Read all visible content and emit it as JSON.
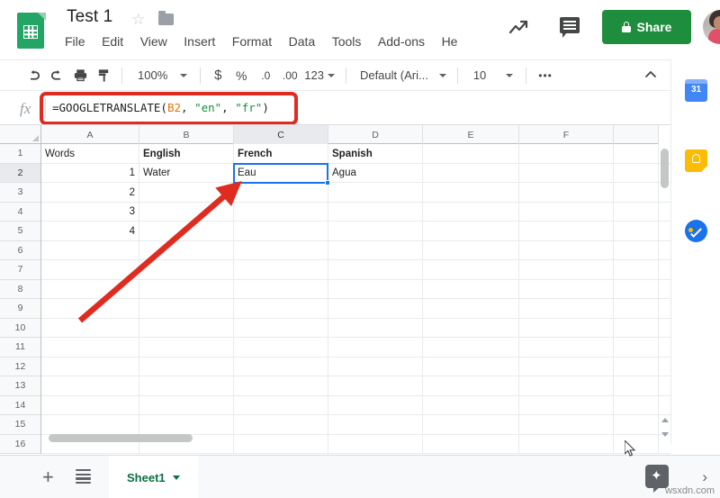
{
  "app": {
    "name": "Google Sheets",
    "logo_icon": "sheets-logo-icon",
    "doc_title": "Test 1",
    "star_icon": "star-icon",
    "folder_icon": "folder-icon"
  },
  "menubar": {
    "items": [
      {
        "label": "File"
      },
      {
        "label": "Edit"
      },
      {
        "label": "View"
      },
      {
        "label": "Insert"
      },
      {
        "label": "Format"
      },
      {
        "label": "Data"
      },
      {
        "label": "Tools"
      },
      {
        "label": "Add-ons"
      },
      {
        "label": "He"
      }
    ]
  },
  "top_actions": {
    "history_icon": "activity-trend-icon",
    "comment_icon": "comment-icon",
    "share_label": "Share",
    "share_lock_icon": "lock-icon",
    "share_color": "#1e8e3e",
    "avatar_icon": "user-avatar"
  },
  "toolbar": {
    "undo_icon": "undo-icon",
    "redo_icon": "redo-icon",
    "print_icon": "print-icon",
    "paint_icon": "paint-format-icon",
    "zoom_value": "100%",
    "currency_label": "$",
    "percent_label": "%",
    "decrease_decimal_label": ".0",
    "increase_decimal_label": ".00",
    "number_format_label": "123",
    "font_family": "Default (Ari...",
    "font_size": "10",
    "more_label": "•••",
    "collapse_icon": "chevron-up-icon"
  },
  "formula_bar": {
    "fx_label": "fx",
    "formula_full": "=GOOGLETRANSLATE(B2, \"en\", \"fr\")",
    "parts": {
      "fn": "=GOOGLETRANSLATE(",
      "ref": "B2",
      "sep1": ", ",
      "arg1": "\"en\"",
      "sep2": ", ",
      "arg2": "\"fr\"",
      "close": ")"
    },
    "ref_color": "#e8710a",
    "string_color": "#1a8f3c",
    "highlight_color": "#e02b20"
  },
  "grid": {
    "columns": [
      {
        "label": "A",
        "width": 109,
        "selected": false
      },
      {
        "label": "B",
        "width": 105,
        "selected": false
      },
      {
        "label": "C",
        "width": 105,
        "selected": true
      },
      {
        "label": "D",
        "width": 105,
        "selected": false
      },
      {
        "label": "E",
        "width": 107,
        "selected": false
      },
      {
        "label": "F",
        "width": 105,
        "selected": false
      },
      {
        "label": "",
        "width": 50,
        "selected": false
      }
    ],
    "rows": [
      {
        "num": "1",
        "selected": false,
        "cells": [
          {
            "v": "Words",
            "bold": false,
            "num": false
          },
          {
            "v": "English",
            "bold": true,
            "num": false
          },
          {
            "v": "French",
            "bold": true,
            "num": false
          },
          {
            "v": "Spanish",
            "bold": true,
            "num": false
          },
          {
            "v": "",
            "bold": false,
            "num": false
          },
          {
            "v": "",
            "bold": false,
            "num": false
          },
          {
            "v": "",
            "bold": false,
            "num": false
          }
        ]
      },
      {
        "num": "2",
        "selected": true,
        "cells": [
          {
            "v": "1",
            "bold": false,
            "num": true
          },
          {
            "v": "Water",
            "bold": false,
            "num": false
          },
          {
            "v": "Eau",
            "bold": false,
            "num": false
          },
          {
            "v": "Agua",
            "bold": false,
            "num": false
          },
          {
            "v": "",
            "bold": false,
            "num": false
          },
          {
            "v": "",
            "bold": false,
            "num": false
          },
          {
            "v": "",
            "bold": false,
            "num": false
          }
        ]
      },
      {
        "num": "3",
        "selected": false,
        "cells": [
          {
            "v": "2",
            "bold": false,
            "num": true
          },
          {
            "v": "",
            "bold": false,
            "num": false
          },
          {
            "v": "",
            "bold": false,
            "num": false
          },
          {
            "v": "",
            "bold": false,
            "num": false
          },
          {
            "v": "",
            "bold": false,
            "num": false
          },
          {
            "v": "",
            "bold": false,
            "num": false
          },
          {
            "v": "",
            "bold": false,
            "num": false
          }
        ]
      },
      {
        "num": "4",
        "selected": false,
        "cells": [
          {
            "v": "3",
            "bold": false,
            "num": true
          },
          {
            "v": "",
            "bold": false,
            "num": false
          },
          {
            "v": "",
            "bold": false,
            "num": false
          },
          {
            "v": "",
            "bold": false,
            "num": false
          },
          {
            "v": "",
            "bold": false,
            "num": false
          },
          {
            "v": "",
            "bold": false,
            "num": false
          },
          {
            "v": "",
            "bold": false,
            "num": false
          }
        ]
      },
      {
        "num": "5",
        "selected": false,
        "cells": [
          {
            "v": "4",
            "bold": false,
            "num": true
          },
          {
            "v": "",
            "bold": false,
            "num": false
          },
          {
            "v": "",
            "bold": false,
            "num": false
          },
          {
            "v": "",
            "bold": false,
            "num": false
          },
          {
            "v": "",
            "bold": false,
            "num": false
          },
          {
            "v": "",
            "bold": false,
            "num": false
          },
          {
            "v": "",
            "bold": false,
            "num": false
          }
        ]
      },
      {
        "num": "6",
        "selected": false,
        "cells": [
          {
            "v": "",
            "bold": false,
            "num": false
          },
          {
            "v": "",
            "bold": false,
            "num": false
          },
          {
            "v": "",
            "bold": false,
            "num": false
          },
          {
            "v": "",
            "bold": false,
            "num": false
          },
          {
            "v": "",
            "bold": false,
            "num": false
          },
          {
            "v": "",
            "bold": false,
            "num": false
          },
          {
            "v": "",
            "bold": false,
            "num": false
          }
        ]
      },
      {
        "num": "7",
        "selected": false,
        "cells": [
          {
            "v": "",
            "bold": false,
            "num": false
          },
          {
            "v": "",
            "bold": false,
            "num": false
          },
          {
            "v": "",
            "bold": false,
            "num": false
          },
          {
            "v": "",
            "bold": false,
            "num": false
          },
          {
            "v": "",
            "bold": false,
            "num": false
          },
          {
            "v": "",
            "bold": false,
            "num": false
          },
          {
            "v": "",
            "bold": false,
            "num": false
          }
        ]
      },
      {
        "num": "8",
        "selected": false,
        "cells": [
          {
            "v": "",
            "bold": false,
            "num": false
          },
          {
            "v": "",
            "bold": false,
            "num": false
          },
          {
            "v": "",
            "bold": false,
            "num": false
          },
          {
            "v": "",
            "bold": false,
            "num": false
          },
          {
            "v": "",
            "bold": false,
            "num": false
          },
          {
            "v": "",
            "bold": false,
            "num": false
          },
          {
            "v": "",
            "bold": false,
            "num": false
          }
        ]
      },
      {
        "num": "9",
        "selected": false,
        "cells": [
          {
            "v": "",
            "bold": false,
            "num": false
          },
          {
            "v": "",
            "bold": false,
            "num": false
          },
          {
            "v": "",
            "bold": false,
            "num": false
          },
          {
            "v": "",
            "bold": false,
            "num": false
          },
          {
            "v": "",
            "bold": false,
            "num": false
          },
          {
            "v": "",
            "bold": false,
            "num": false
          },
          {
            "v": "",
            "bold": false,
            "num": false
          }
        ]
      },
      {
        "num": "10",
        "selected": false,
        "cells": [
          {
            "v": "",
            "bold": false,
            "num": false
          },
          {
            "v": "",
            "bold": false,
            "num": false
          },
          {
            "v": "",
            "bold": false,
            "num": false
          },
          {
            "v": "",
            "bold": false,
            "num": false
          },
          {
            "v": "",
            "bold": false,
            "num": false
          },
          {
            "v": "",
            "bold": false,
            "num": false
          },
          {
            "v": "",
            "bold": false,
            "num": false
          }
        ]
      },
      {
        "num": "11",
        "selected": false,
        "cells": [
          {
            "v": "",
            "bold": false,
            "num": false
          },
          {
            "v": "",
            "bold": false,
            "num": false
          },
          {
            "v": "",
            "bold": false,
            "num": false
          },
          {
            "v": "",
            "bold": false,
            "num": false
          },
          {
            "v": "",
            "bold": false,
            "num": false
          },
          {
            "v": "",
            "bold": false,
            "num": false
          },
          {
            "v": "",
            "bold": false,
            "num": false
          }
        ]
      },
      {
        "num": "12",
        "selected": false,
        "cells": [
          {
            "v": "",
            "bold": false,
            "num": false
          },
          {
            "v": "",
            "bold": false,
            "num": false
          },
          {
            "v": "",
            "bold": false,
            "num": false
          },
          {
            "v": "",
            "bold": false,
            "num": false
          },
          {
            "v": "",
            "bold": false,
            "num": false
          },
          {
            "v": "",
            "bold": false,
            "num": false
          },
          {
            "v": "",
            "bold": false,
            "num": false
          }
        ]
      },
      {
        "num": "13",
        "selected": false,
        "cells": [
          {
            "v": "",
            "bold": false,
            "num": false
          },
          {
            "v": "",
            "bold": false,
            "num": false
          },
          {
            "v": "",
            "bold": false,
            "num": false
          },
          {
            "v": "",
            "bold": false,
            "num": false
          },
          {
            "v": "",
            "bold": false,
            "num": false
          },
          {
            "v": "",
            "bold": false,
            "num": false
          },
          {
            "v": "",
            "bold": false,
            "num": false
          }
        ]
      },
      {
        "num": "14",
        "selected": false,
        "cells": [
          {
            "v": "",
            "bold": false,
            "num": false
          },
          {
            "v": "",
            "bold": false,
            "num": false
          },
          {
            "v": "",
            "bold": false,
            "num": false
          },
          {
            "v": "",
            "bold": false,
            "num": false
          },
          {
            "v": "",
            "bold": false,
            "num": false
          },
          {
            "v": "",
            "bold": false,
            "num": false
          },
          {
            "v": "",
            "bold": false,
            "num": false
          }
        ]
      },
      {
        "num": "15",
        "selected": false,
        "cells": [
          {
            "v": "",
            "bold": false,
            "num": false
          },
          {
            "v": "",
            "bold": false,
            "num": false
          },
          {
            "v": "",
            "bold": false,
            "num": false
          },
          {
            "v": "",
            "bold": false,
            "num": false
          },
          {
            "v": "",
            "bold": false,
            "num": false
          },
          {
            "v": "",
            "bold": false,
            "num": false
          },
          {
            "v": "",
            "bold": false,
            "num": false
          }
        ]
      },
      {
        "num": "16",
        "selected": false,
        "cells": [
          {
            "v": "",
            "bold": false,
            "num": false
          },
          {
            "v": "",
            "bold": false,
            "num": false
          },
          {
            "v": "",
            "bold": false,
            "num": false
          },
          {
            "v": "",
            "bold": false,
            "num": false
          },
          {
            "v": "",
            "bold": false,
            "num": false
          },
          {
            "v": "",
            "bold": false,
            "num": false
          },
          {
            "v": "",
            "bold": false,
            "num": false
          }
        ]
      }
    ],
    "selected_cell": "C2",
    "selection_color": "#1a73e8"
  },
  "side_panel": {
    "items": [
      {
        "icon": "google-calendar-icon",
        "day": "31"
      },
      {
        "icon": "google-keep-icon"
      },
      {
        "icon": "google-tasks-icon"
      }
    ]
  },
  "bottom_bar": {
    "add_sheet_icon": "add-sheet-icon",
    "all_sheets_icon": "all-sheets-icon",
    "sheet_tab_label": "Sheet1",
    "sheet_tab_caret": "chevron-down-icon",
    "explore_icon": "explore-icon",
    "panel_toggle_icon": "chevron-right-icon"
  },
  "annotations": {
    "arrow_color": "#e02b20",
    "arrow_target": "C2",
    "watermark": "wsxdn.com",
    "cursor_icon": "mouse-pointer-icon"
  }
}
